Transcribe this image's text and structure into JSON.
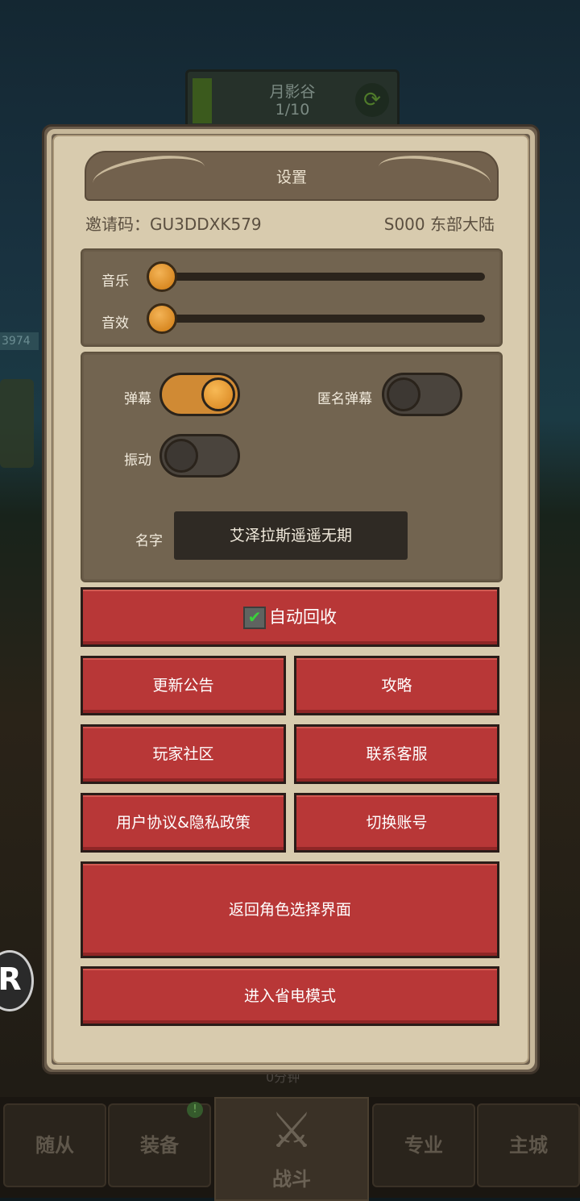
{
  "background": {
    "stage": {
      "title": "月影谷",
      "progress": "1/10"
    },
    "left_hud_value": "3974",
    "bottom_hint": "0分钟",
    "bottom_nav": [
      {
        "label": "随从"
      },
      {
        "label": "装备"
      },
      {
        "label": "战斗"
      },
      {
        "label": "专业"
      },
      {
        "label": "主城"
      }
    ]
  },
  "dialog": {
    "title": "设置",
    "invite": "邀请码：GU3DDXK579",
    "server": "S000 东部大陆",
    "audio": {
      "music_label": "音乐",
      "music_value": 0,
      "sfx_label": "音效",
      "sfx_value": 0
    },
    "options": {
      "danmaku_label": "弹幕",
      "danmaku_on": true,
      "anon_danmaku_label": "匿名弹幕",
      "anon_danmaku_on": false,
      "vibrate_label": "振动",
      "vibrate_on": false,
      "name_label": "名字",
      "name_value": "艾泽拉斯遥遥无期"
    },
    "buttons": {
      "auto_recycle": "自动回收",
      "auto_recycle_checked": true,
      "update_notice": "更新公告",
      "guide": "攻略",
      "community": "玩家社区",
      "support": "联系客服",
      "agreement": "用户协议&隐私政策",
      "switch_account": "切换账号",
      "back_to_character": "返回角色选择界面",
      "power_save": "进入省电模式"
    }
  },
  "colors": {
    "button_red": "#b83737",
    "panel_brown": "#726450",
    "parchment": "#d8cbae",
    "toggle_on": "#d08a34"
  }
}
